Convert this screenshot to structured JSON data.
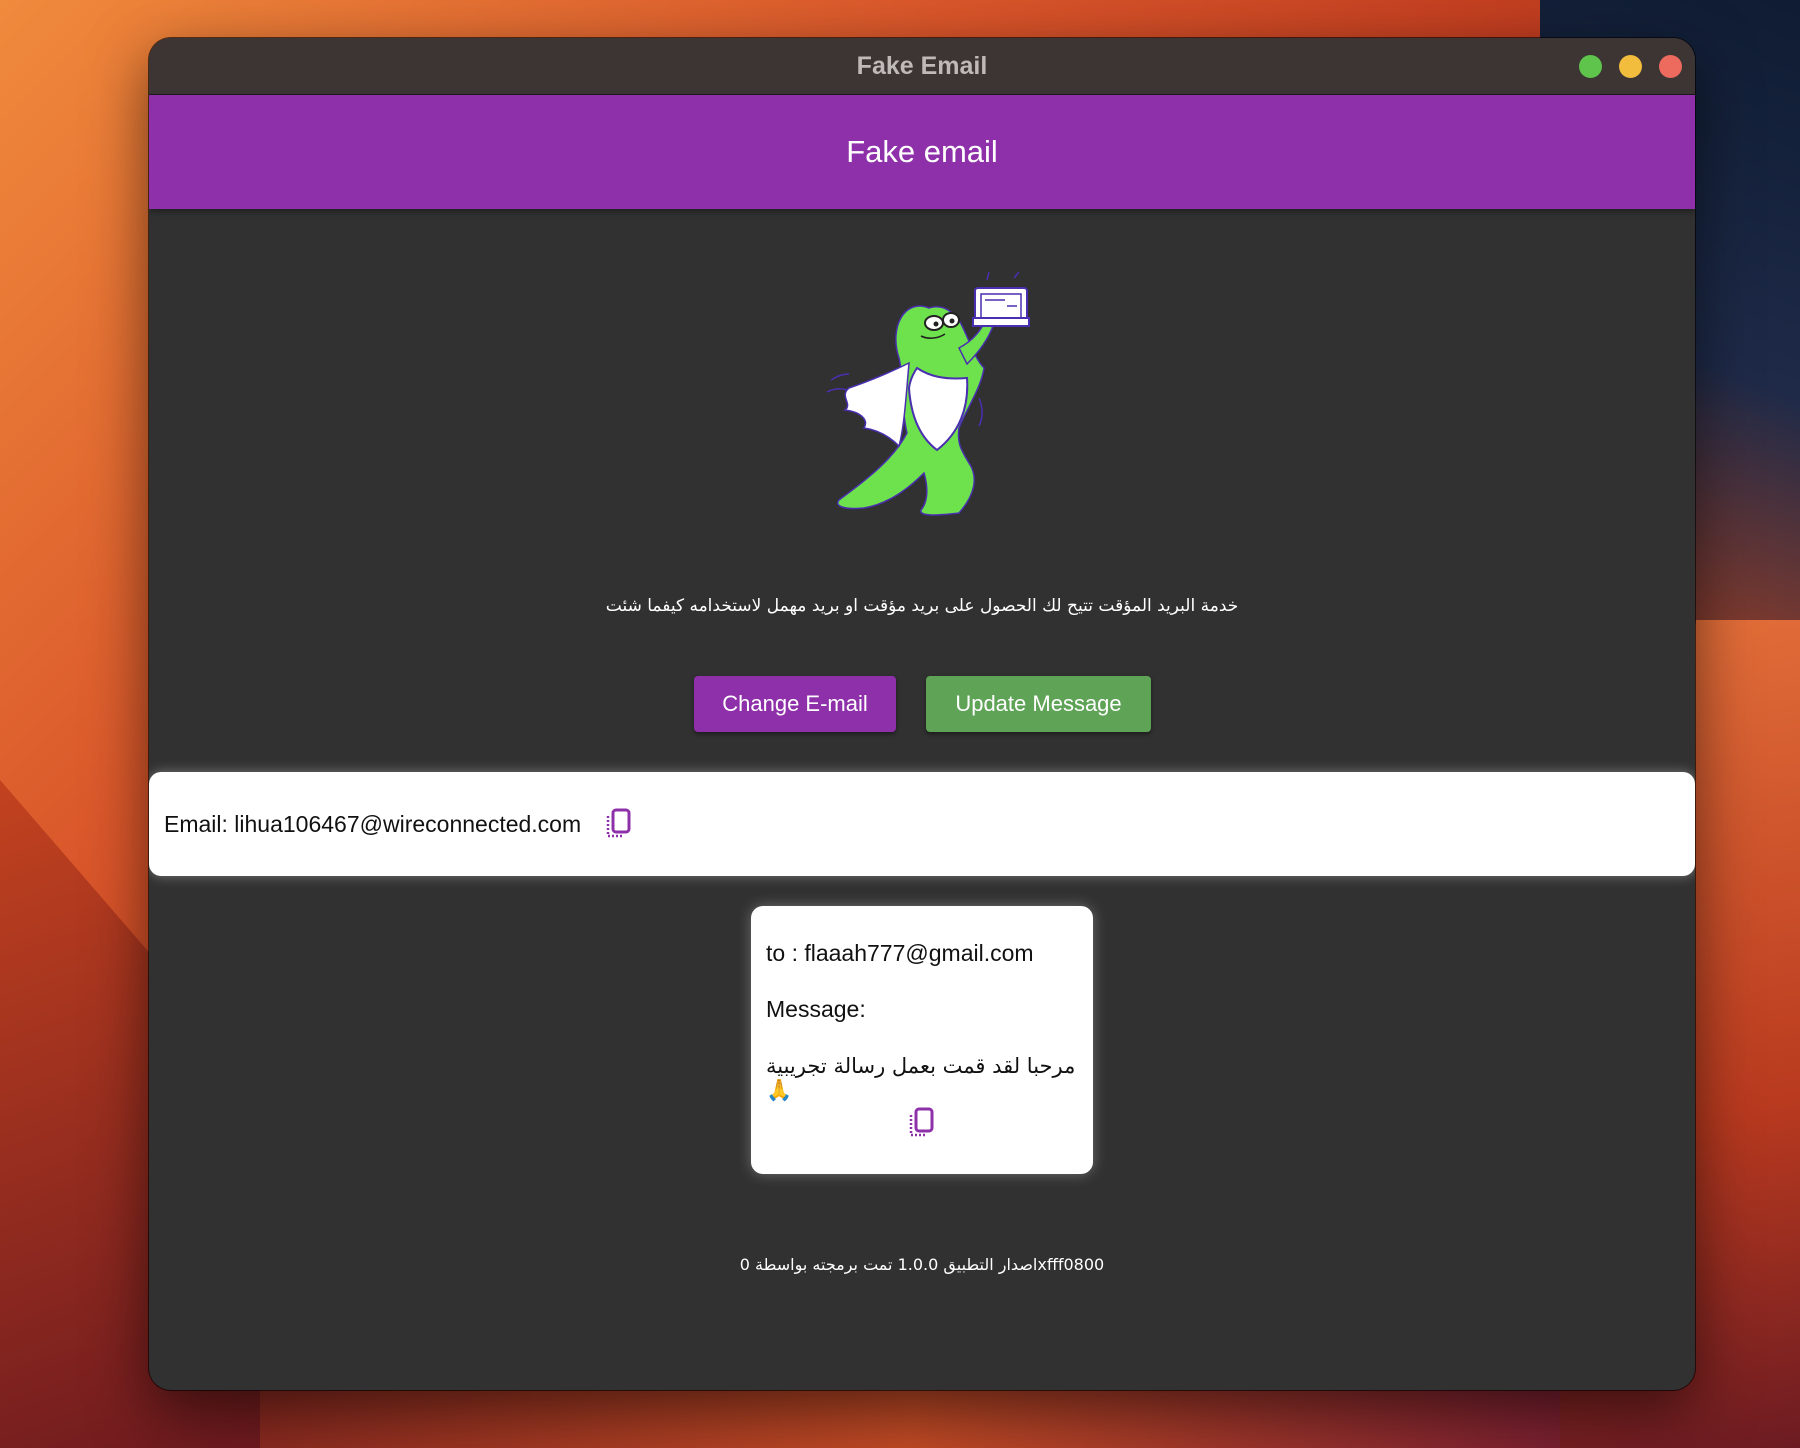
{
  "window": {
    "title": "Fake Email"
  },
  "appbar": {
    "title": "Fake email"
  },
  "description": "خدمة البريد المؤقت تتيح لك الحصول على بريد مؤقت او بريد مهمل لاستخدامه كيفما شئت",
  "buttons": {
    "change_label": "Change E-mail",
    "update_label": "Update Message",
    "change_color": "#8e30a9",
    "update_color": "#5fa357"
  },
  "email_card": {
    "text": "Email: lihua106467@wireconnected.com",
    "copy_icon": "copy-icon"
  },
  "message_card": {
    "to": "to : flaaah777@gmail.com",
    "label": "Message:",
    "body": "مرحبا لقد قمت بعمل رسالة تجريبية 🙏",
    "copy_icon": "copy-icon"
  },
  "footer": "اصدار التطبيق 1.0.0 تمت برمجته بواسطة 0xfff0800",
  "colors": {
    "accent": "#8e30a9",
    "success": "#5fa357",
    "background": "#313131"
  }
}
